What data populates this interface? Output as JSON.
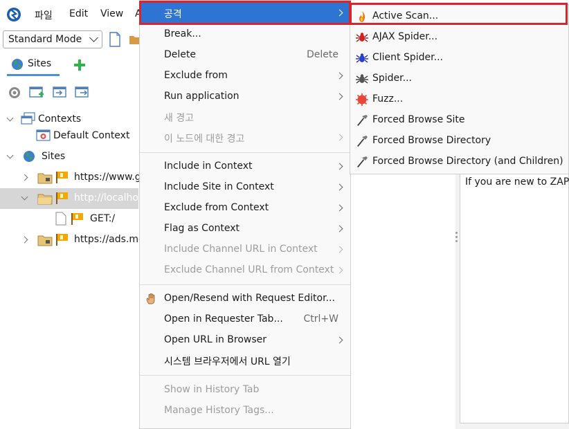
{
  "menubar": {
    "items": [
      "파일",
      "Edit",
      "View",
      "A"
    ]
  },
  "toolbar": {
    "mode_value": "Standard Mode"
  },
  "tabs": {
    "sites_label": "Sites"
  },
  "tree": {
    "contexts_label": "Contexts",
    "default_context_label": "Default Context",
    "sites_label": "Sites",
    "site1_label": "https://www.go",
    "site2_label": "http://localhost",
    "get_label": "GET:/",
    "site3_label": "https://ads.mo"
  },
  "info_panel": {
    "text": "If you are new to ZAP th"
  },
  "context_menu": {
    "attack": "공격",
    "break": "Break...",
    "delete": "Delete",
    "delete_shortcut": "Delete",
    "exclude_from": "Exclude from",
    "run_application": "Run application",
    "new_alert": "새 경고",
    "alerts_for_node": "이 노드에 대한 경고",
    "include_in_context": "Include in Context",
    "include_site_in_context": "Include Site in Context",
    "exclude_from_context": "Exclude from Context",
    "flag_as_context": "Flag as Context",
    "include_channel_url": "Include Channel URL in Context",
    "exclude_channel_url": "Exclude Channel URL from Context",
    "open_resend": "Open/Resend with Request Editor...",
    "open_requester_tab": "Open in Requester Tab...",
    "open_requester_shortcut": "Ctrl+W",
    "open_url_browser": "Open URL in Browser",
    "open_system_browser": "시스템 브라우저에서 URL 열기",
    "show_history_tab": "Show in History Tab",
    "manage_history_tags": "Manage History Tags..."
  },
  "submenu": {
    "active_scan": "Active Scan...",
    "ajax_spider": "AJAX Spider...",
    "client_spider": "Client Spider...",
    "spider": "Spider...",
    "fuzz": "Fuzz...",
    "forced_browse_site": "Forced Browse Site",
    "forced_browse_dir": "Forced Browse Directory",
    "forced_browse_dir_children": "Forced Browse Directory (and Children)"
  },
  "colors": {
    "highlight": "#2e74d3",
    "annotation_red": "#d9232e",
    "selected_row": "#d6d6d6"
  }
}
